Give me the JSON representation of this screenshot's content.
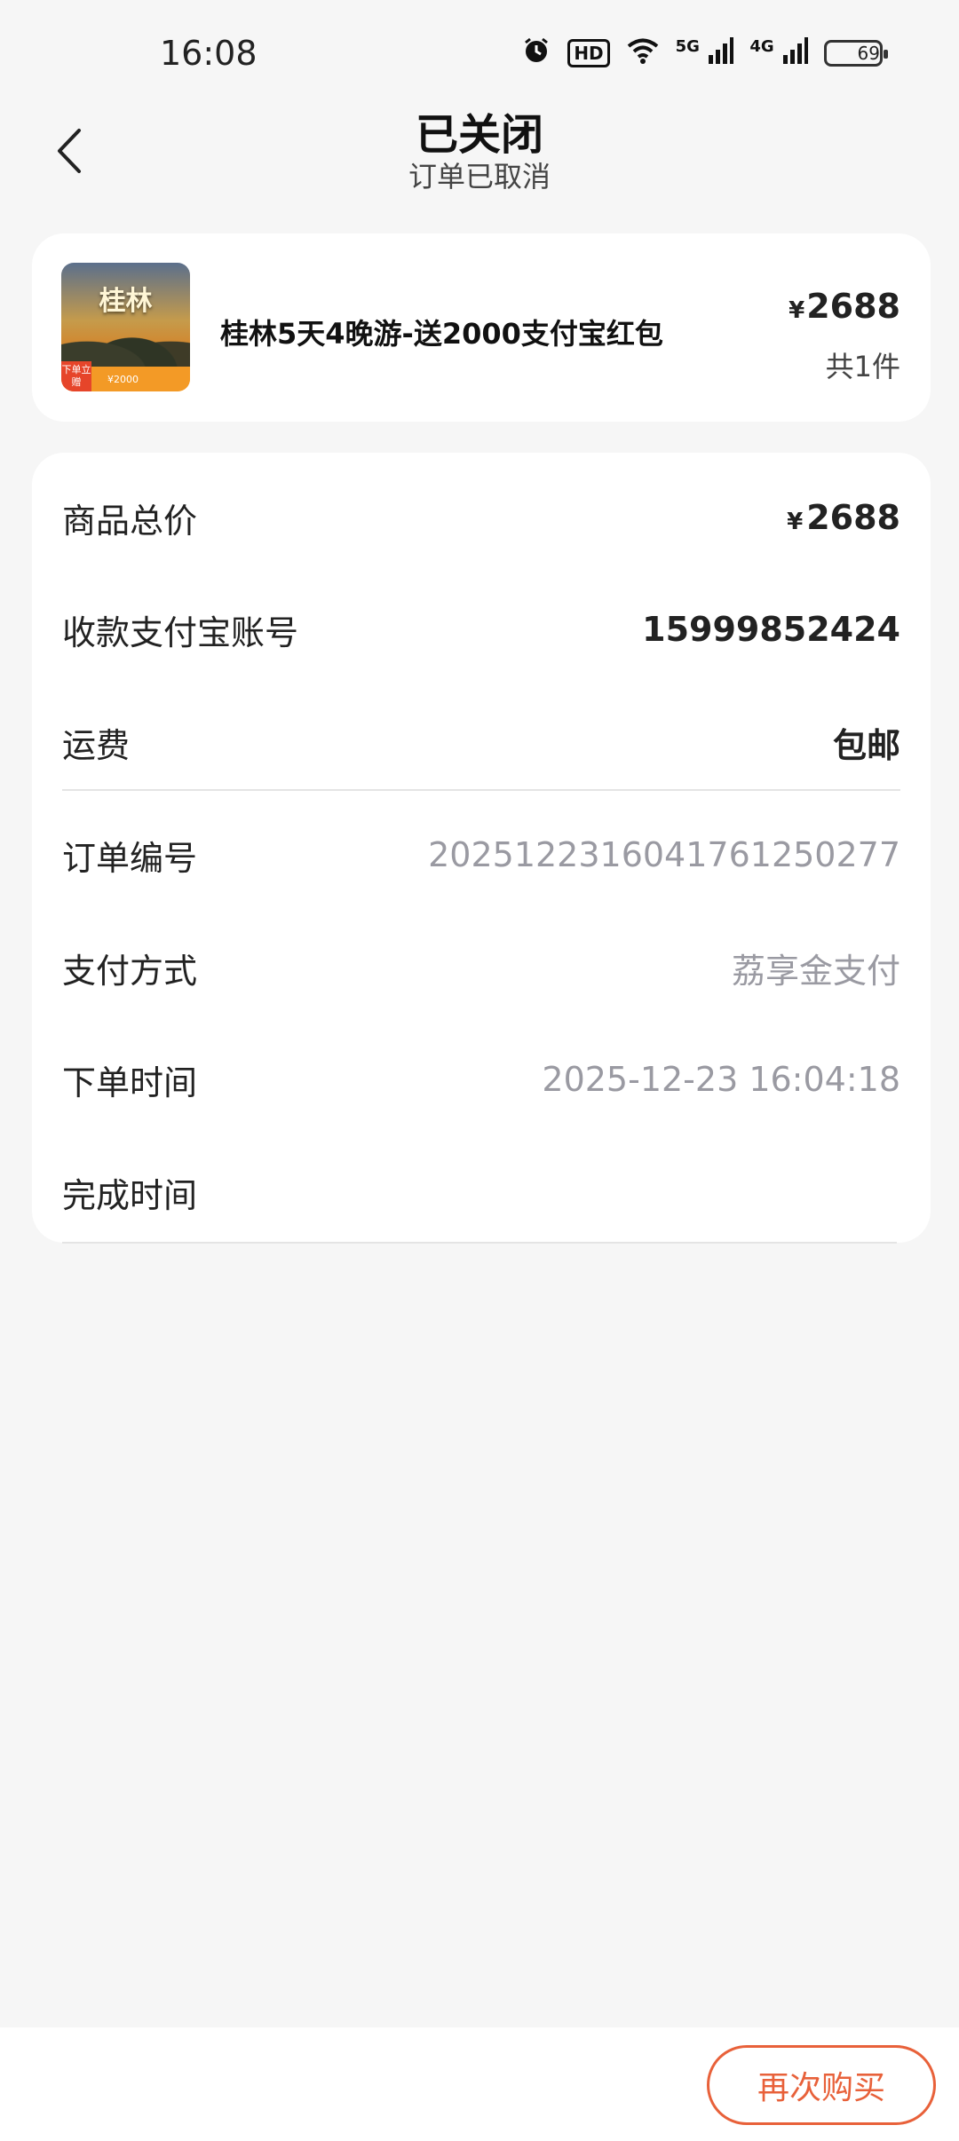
{
  "status_bar": {
    "time": "16:08",
    "icons": [
      "alarm-icon",
      "hd-icon",
      "wifi-icon",
      "signal-5g-icon",
      "signal-4g-icon",
      "battery-icon"
    ],
    "hd_label": "HD",
    "net1": "5G",
    "net2": "4G",
    "battery_level": "69"
  },
  "header": {
    "title": "已关闭",
    "subtitle": "订单已取消"
  },
  "product": {
    "thumb_title": "桂林",
    "thumb_tag": "下单立赠",
    "thumb_band": "¥2000",
    "name": "桂林5天4晚游-送2000支付宝红包",
    "currency": "¥",
    "price": "2688",
    "count": "共1件"
  },
  "details": {
    "total_label": "商品总价",
    "total_currency": "¥",
    "total_value": "2688",
    "account_label": "收款支付宝账号",
    "account_value": "15999852424",
    "shipping_label": "运费",
    "shipping_value": "包邮",
    "order_no_label": "订单编号",
    "order_no_value": "20251223160417612502​77",
    "payment_label": "支付方式",
    "payment_value": "荔享金支付",
    "order_time_label": "下单时间",
    "order_time_value": "2025-12-23 16:04:18",
    "finish_time_label": "完成时间",
    "finish_time_value": ""
  },
  "actions": {
    "rebuy_label": "再次购买"
  },
  "colors": {
    "accent": "#e8613a",
    "background": "#f6f6f6",
    "muted_text": "#9a9aa2"
  }
}
